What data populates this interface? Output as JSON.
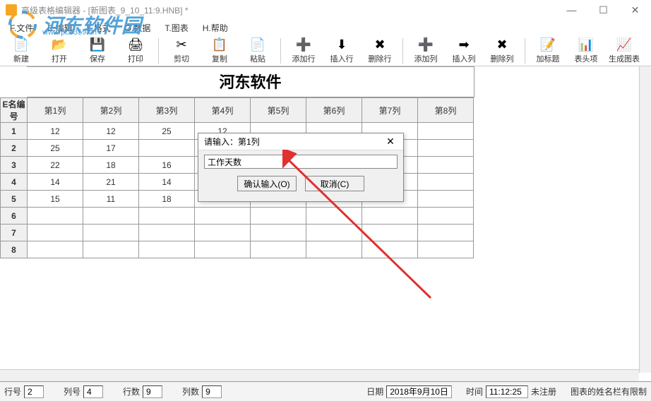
{
  "window": {
    "title": "高级表格编辑器 - [新图表_9_10_11:9.HNB] *"
  },
  "menu": {
    "file": "F.文件",
    "edit": "E.编辑",
    "format": "L.格式",
    "data": "O.数据",
    "chart": "T.图表",
    "help": "H.帮助"
  },
  "toolbar": {
    "new": "新建",
    "open": "打开",
    "save": "保存",
    "print": "打印",
    "cut": "剪切",
    "copy": "复制",
    "paste": "粘贴",
    "addrow": "添加行",
    "insertrow": "插入行",
    "delrow": "删除行",
    "addcol": "添加列",
    "insertcol": "插入列",
    "delcol": "删除列",
    "addtitle": "加标题",
    "header": "表头项",
    "genchart": "生成图表"
  },
  "sheet": {
    "title": "河东软件",
    "corner": "E名编号",
    "columns": [
      "第1列",
      "第2列",
      "第3列",
      "第4列",
      "第5列",
      "第6列",
      "第7列",
      "第8列"
    ],
    "rows": [
      {
        "n": "1",
        "cells": [
          "12",
          "12",
          "25",
          "12",
          "",
          "",
          "",
          ""
        ]
      },
      {
        "n": "2",
        "cells": [
          "25",
          "17",
          "",
          "",
          "",
          "",
          "",
          ""
        ]
      },
      {
        "n": "3",
        "cells": [
          "22",
          "18",
          "16",
          "",
          "",
          "",
          "",
          ""
        ]
      },
      {
        "n": "4",
        "cells": [
          "14",
          "21",
          "14",
          "",
          "",
          "",
          "",
          ""
        ]
      },
      {
        "n": "5",
        "cells": [
          "15",
          "11",
          "18",
          "",
          "",
          "",
          "",
          ""
        ]
      },
      {
        "n": "6",
        "cells": [
          "",
          "",
          "",
          "",
          "",
          "",
          "",
          ""
        ]
      },
      {
        "n": "7",
        "cells": [
          "",
          "",
          "",
          "",
          "",
          "",
          "",
          ""
        ]
      },
      {
        "n": "8",
        "cells": [
          "",
          "",
          "",
          "",
          "",
          "",
          "",
          ""
        ]
      }
    ]
  },
  "dialog": {
    "title": "请输入：第1列",
    "value": "工作天数",
    "ok": "确认输入(O)",
    "cancel": "取消(C)"
  },
  "status": {
    "row_label": "行号",
    "row_val": "2",
    "col_label": "列号",
    "col_val": "4",
    "rows_label": "行数",
    "rows_val": "9",
    "cols_label": "列数",
    "cols_val": "9",
    "date_label": "日期",
    "date_val": "2018年9月10日",
    "time_label": "时间",
    "time_val": "11:12:25",
    "reg": "未注册",
    "note": "图表的姓名栏有限制"
  },
  "logo": {
    "text": "河东软件园",
    "url": "www.pc0359.cn"
  }
}
